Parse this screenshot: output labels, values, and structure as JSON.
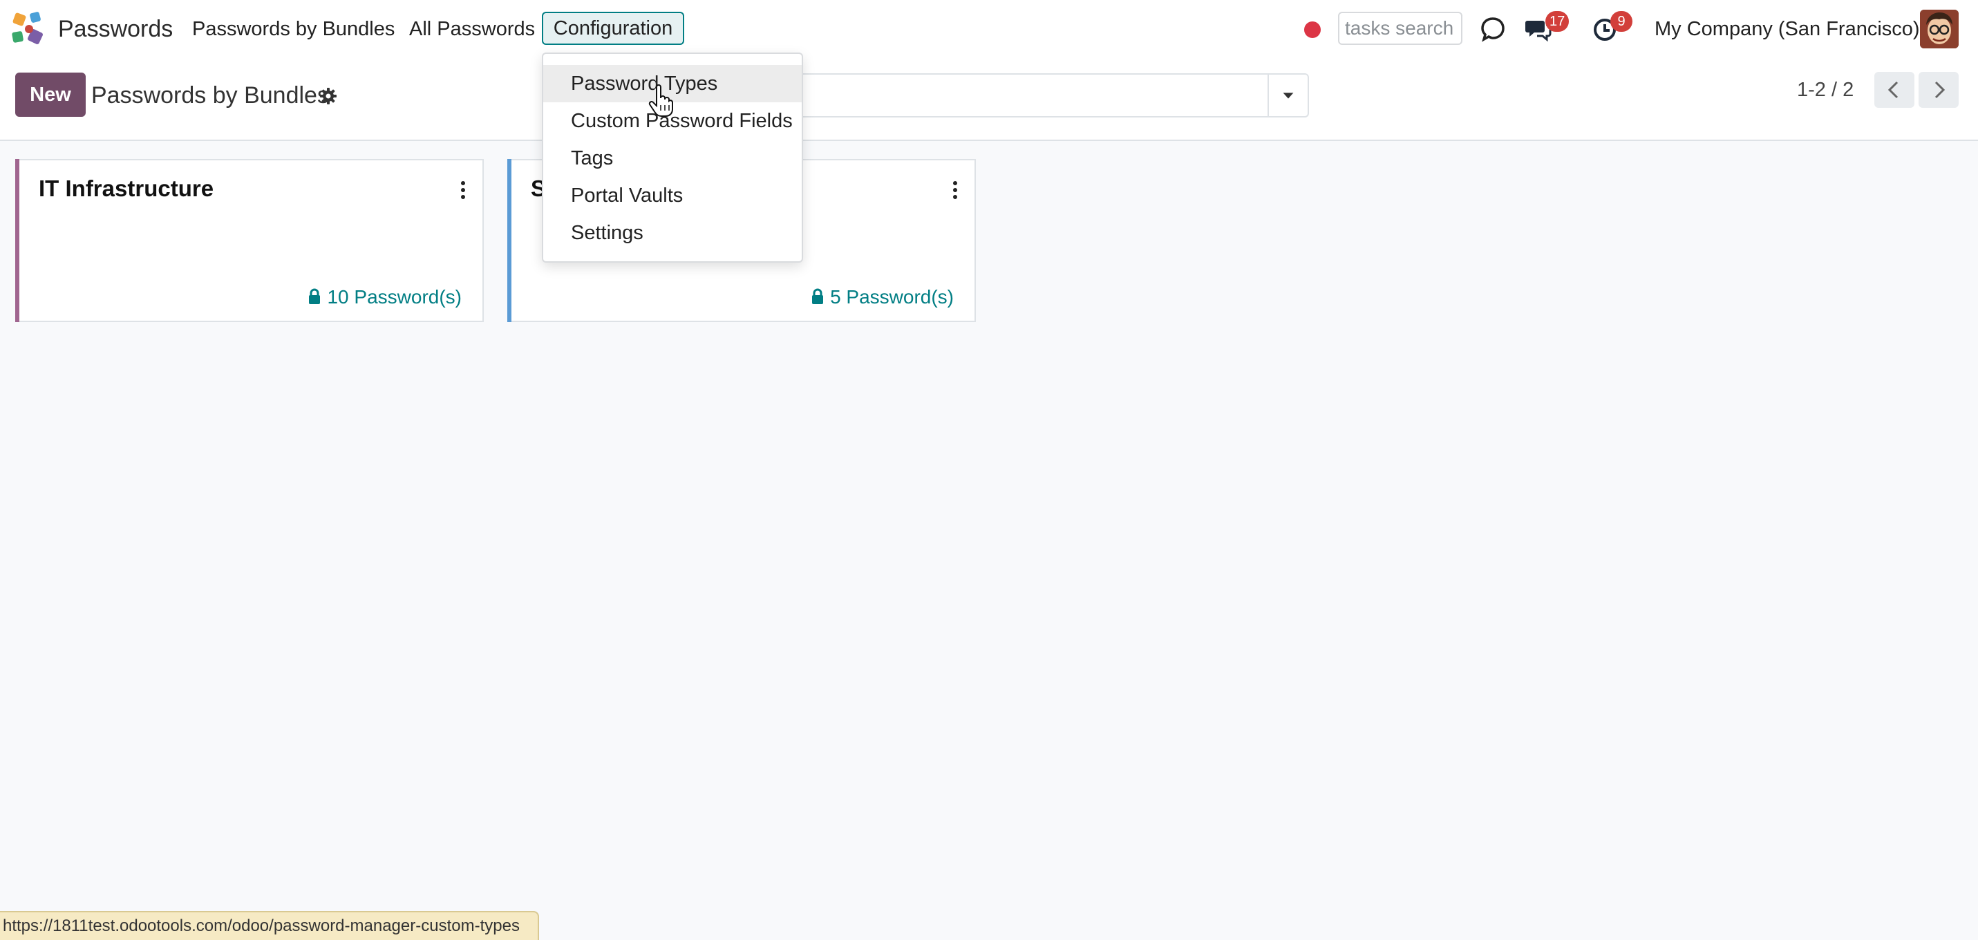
{
  "navbar": {
    "app_name": "Passwords",
    "menu": {
      "bundles": "Passwords by Bundles",
      "all": "All Passwords",
      "configuration": "Configuration"
    },
    "tasks_search_placeholder": "tasks search",
    "messages_badge": "17",
    "activities_badge": "9",
    "company": "My Company (San Francisco)",
    "icons": [
      "app-logo-icon",
      "record-dot-icon",
      "discuss-icon",
      "messages-icon",
      "activity-clock-icon",
      "user-avatar"
    ]
  },
  "control_panel": {
    "new_label": "New",
    "title": "Passwords by Bundles",
    "pager": "1-2 / 2"
  },
  "cards": [
    {
      "title": "IT Infrastructure",
      "count": "10 Password(s)",
      "stripe": "#a0658f"
    },
    {
      "title": "S",
      "count": "5 Password(s)",
      "stripe": "#5b9bd5"
    }
  ],
  "config_menu": {
    "items": [
      "Password Types",
      "Custom Password Fields",
      "Tags",
      "Portal Vaults",
      "Settings"
    ],
    "hovered": "Password Types"
  },
  "status_url": "https://1811test.odootools.com/odoo/password-manager-custom-types",
  "colors": {
    "primary": "#714b67",
    "accent": "#017e84",
    "badge": "#d23f3a"
  }
}
